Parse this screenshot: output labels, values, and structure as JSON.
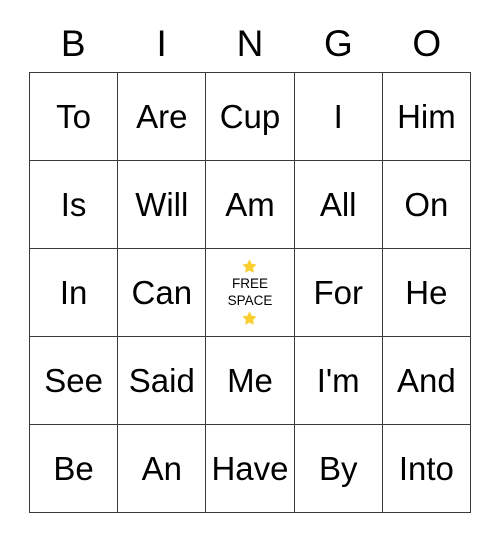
{
  "card": {
    "headers": [
      "B",
      "I",
      "N",
      "G",
      "O"
    ],
    "free_space": {
      "line1": "FREE",
      "line2": "SPACE",
      "star_icon": "star-icon",
      "star_color": "#f9ce2e",
      "star_count": 2
    },
    "rows": [
      [
        {
          "label": "To",
          "free": false
        },
        {
          "label": "Are",
          "free": false
        },
        {
          "label": "Cup",
          "free": false
        },
        {
          "label": "I",
          "free": false
        },
        {
          "label": "Him",
          "free": false
        }
      ],
      [
        {
          "label": "Is",
          "free": false
        },
        {
          "label": "Will",
          "free": false
        },
        {
          "label": "Am",
          "free": false
        },
        {
          "label": "All",
          "free": false
        },
        {
          "label": "On",
          "free": false
        }
      ],
      [
        {
          "label": "In",
          "free": false
        },
        {
          "label": "Can",
          "free": false
        },
        {
          "label": "",
          "free": true
        },
        {
          "label": "For",
          "free": false
        },
        {
          "label": "He",
          "free": false
        }
      ],
      [
        {
          "label": "See",
          "free": false
        },
        {
          "label": "Said",
          "free": false
        },
        {
          "label": "Me",
          "free": false
        },
        {
          "label": "I'm",
          "free": false
        },
        {
          "label": "And",
          "free": false
        }
      ],
      [
        {
          "label": "Be",
          "free": false
        },
        {
          "label": "An",
          "free": false
        },
        {
          "label": "Have",
          "free": false
        },
        {
          "label": "By",
          "free": false
        },
        {
          "label": "Into",
          "free": false
        }
      ]
    ]
  },
  "colors": {
    "grid_line": "#3a3a3a",
    "text": "#000000",
    "background": "#ffffff",
    "star": "#f9ce2e"
  }
}
